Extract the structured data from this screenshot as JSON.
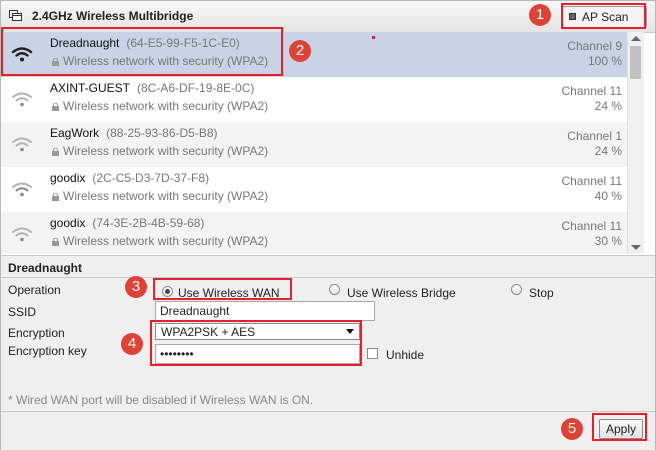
{
  "window": {
    "title": "2.4GHz Wireless Multibridge",
    "title_icon": "window-stack-icon"
  },
  "toolbar": {
    "ap_scan_label": "AP Scan",
    "ap_scan_icon": "scan-icon"
  },
  "networks": [
    {
      "ssid": "Dreadnaught",
      "bssid": "(64-E5-99-F5-1C-E0)",
      "security": "Wireless network with security (WPA2)",
      "channel": "Channel 9",
      "signal": "100 %",
      "signal_level": 1.0,
      "selected": true
    },
    {
      "ssid": "AXINT-GUEST",
      "bssid": "(8C-A6-DF-19-8E-0C)",
      "security": "Wireless network with security (WPA2)",
      "channel": "Channel 11",
      "signal": "24 %",
      "signal_level": 0.24
    },
    {
      "ssid": "EagWork",
      "bssid": "(88-25-93-86-D5-B8)",
      "security": "Wireless network with security (WPA2)",
      "channel": "Channel 1",
      "signal": "24 %",
      "signal_level": 0.24
    },
    {
      "ssid": "goodix",
      "bssid": "(2C-C5-D3-7D-37-F8)",
      "security": "Wireless network with security (WPA2)",
      "channel": "Channel 11",
      "signal": "40 %",
      "signal_level": 0.4
    },
    {
      "ssid": "goodix",
      "bssid": "(74-3E-2B-4B-59-68)",
      "security": "Wireless network with security (WPA2)",
      "channel": "Channel 11",
      "signal": "30 %",
      "signal_level": 0.3
    }
  ],
  "details": {
    "title": "Dreadnaught",
    "operation_label": "Operation",
    "options": {
      "wireless_wan": "Use Wireless WAN",
      "wireless_bridge": "Use Wireless Bridge",
      "stop": "Stop"
    },
    "selected_option": "wireless_wan",
    "ssid_label": "SSID",
    "ssid_value": "Dreadnaught",
    "encryption_label": "Encryption",
    "encryption_value": "WPA2PSK + AES",
    "key_label": "Encryption key",
    "key_value": "••••••••",
    "unhide_label": "Unhide",
    "note": "* Wired WAN port will be disabled if Wireless WAN is ON."
  },
  "footer": {
    "apply_label": "Apply"
  },
  "callouts": [
    "1",
    "2",
    "3",
    "4",
    "5"
  ],
  "colors": {
    "highlight": "#e8202e",
    "badge": "#e04235",
    "selected_row": "#c8d3e5",
    "signal_active": "#222222",
    "signal_weak": "#a8a8a8"
  }
}
